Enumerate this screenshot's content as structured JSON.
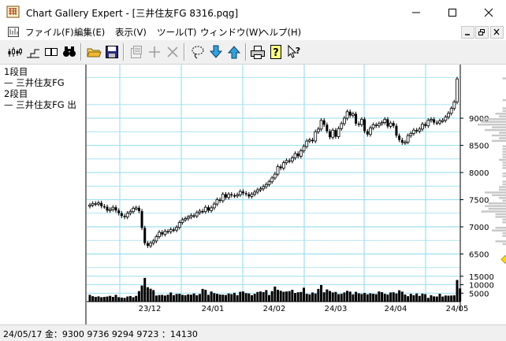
{
  "window": {
    "title": "Chart Gallery Expert - [三井住友FG 8316.pqg]"
  },
  "menu": {
    "items": [
      {
        "label": "ファイル(F)"
      },
      {
        "label": "編集(E)"
      },
      {
        "label": "表示(V)"
      },
      {
        "label": "ツール(T)"
      },
      {
        "label": "ウィンドウ(W)"
      },
      {
        "label": "ヘルプ(H)"
      }
    ]
  },
  "toolbar": {
    "buttons": [
      "candlestick-icon",
      "step-chart-icon",
      "split-view-icon",
      "binoculars-icon",
      "open-folder-icon",
      "save-disk-icon",
      "properties-icon",
      "plus-icon",
      "cross-icon",
      "lasso-icon",
      "download-arrow-icon",
      "upload-arrow-icon",
      "printer-icon",
      "help-icon",
      "context-help-icon"
    ]
  },
  "left_panel": {
    "tier1_label": "1段目",
    "tier1_series": "— 三井住友FG",
    "tier2_label": "2段目",
    "tier2_series": "— 三井住友FG 出"
  },
  "colors": {
    "grid": "#9cdfee",
    "price_axis_hist": "#c8c8c8",
    "marker": "#ffd800",
    "candle": "#000000"
  },
  "chart_data": {
    "type": "candlestick",
    "price_axis": {
      "ticks": [
        "9000",
        "8500",
        "8000",
        "7500",
        "7000",
        "6500"
      ],
      "range": [
        6000,
        9900
      ]
    },
    "volume_axis": {
      "ticks": [
        "15000",
        "10000",
        "5000"
      ],
      "range": [
        0,
        20000
      ]
    },
    "x_ticks": [
      "23/12",
      "24/01",
      "24/02",
      "24/03",
      "24/04",
      "24/05"
    ],
    "closes": [
      7400,
      7430,
      7420,
      7440,
      7380,
      7370,
      7300,
      7320,
      7360,
      7300,
      7250,
      7200,
      7180,
      7250,
      7280,
      7340,
      7350,
      7290,
      6980,
      6700,
      6650,
      6700,
      6740,
      6820,
      6900,
      6860,
      6920,
      6910,
      6950,
      6940,
      6990,
      7080,
      7130,
      7150,
      7180,
      7210,
      7200,
      7260,
      7290,
      7280,
      7360,
      7300,
      7350,
      7420,
      7500,
      7480,
      7600,
      7540,
      7600,
      7580,
      7570,
      7590,
      7650,
      7620,
      7600,
      7560,
      7600,
      7640,
      7680,
      7700,
      7740,
      7780,
      7830,
      7900,
      7970,
      8110,
      8080,
      8180,
      8220,
      8210,
      8270,
      8350,
      8300,
      8400,
      8480,
      8580,
      8600,
      8580,
      8750,
      8800,
      8960,
      8880,
      8760,
      8650,
      8780,
      8660,
      8810,
      8900,
      9000,
      9120,
      9050,
      9080,
      8900,
      8880,
      8980,
      8760,
      8700,
      8820,
      8880,
      8860,
      8900,
      8920,
      8980,
      8850,
      8910,
      8860,
      8680,
      8600,
      8550,
      8560,
      8680,
      8720,
      8780,
      8760,
      8800,
      8890,
      8860,
      8960,
      8980,
      8920,
      8910,
      8950,
      8960,
      9020,
      9090,
      9180,
      9300,
      9723
    ],
    "volumes": [
      4000,
      3200,
      2800,
      3100,
      2600,
      2800,
      3000,
      3400,
      2800,
      4000,
      2600,
      2400,
      2200,
      3000,
      3300,
      2600,
      3400,
      6200,
      9500,
      14000,
      8500,
      7600,
      6800,
      3600,
      3900,
      4000,
      3600,
      4100,
      5400,
      3800,
      4500,
      4600,
      4000,
      3800,
      4300,
      4100,
      4800,
      3800,
      4500,
      7500,
      7000,
      4000,
      6000,
      5000,
      4600,
      4200,
      4100,
      3900,
      4800,
      4400,
      5200,
      3800,
      5800,
      6000,
      5000,
      4800,
      3800,
      4600,
      5700,
      6000,
      5600,
      6800,
      3900,
      6200,
      8900,
      7000,
      6400,
      5800,
      6000,
      6200,
      7000,
      5100,
      5500,
      5700,
      8200,
      4600,
      4300,
      5400,
      4800,
      7500,
      9800,
      5500,
      7200,
      6300,
      5400,
      5700,
      4400,
      4600,
      5400,
      6400,
      5900,
      4300,
      5800,
      4900,
      4500,
      5100,
      4300,
      4900,
      4600,
      4400,
      6000,
      5600,
      4600,
      4200,
      5400,
      5500,
      4800,
      6700,
      5900,
      4200,
      3200,
      4600,
      3800,
      4800,
      3400,
      4700,
      4400,
      2200,
      3800,
      3100,
      3000,
      4600,
      3000,
      3600,
      3500,
      3600,
      3700,
      12800,
      7800
    ]
  },
  "status": {
    "text": "24/05/17 金：9300 9736 9294 9723 ：14130"
  }
}
